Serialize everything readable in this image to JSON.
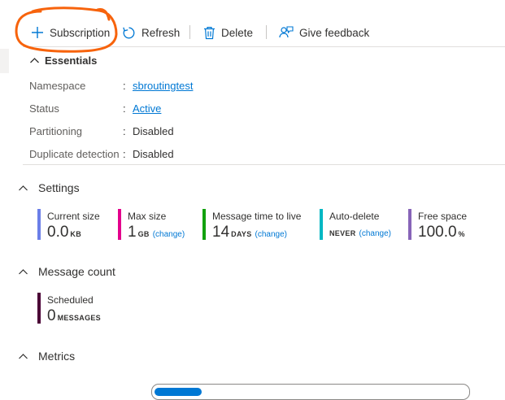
{
  "toolbar": {
    "subscription_label": "Subscription",
    "refresh_label": "Refresh",
    "delete_label": "Delete",
    "feedback_label": "Give feedback"
  },
  "essentials": {
    "title": "Essentials",
    "rows": [
      {
        "label": "Namespace",
        "value": "sbroutingtest"
      },
      {
        "label": "Status",
        "value": "Active"
      },
      {
        "label": "Partitioning",
        "value": "Disabled"
      },
      {
        "label": "Duplicate detection",
        "value": "Disabled"
      }
    ]
  },
  "settings": {
    "title": "Settings",
    "tiles": [
      {
        "label": "Current size",
        "value": "0.0",
        "unit": "KB",
        "change": "",
        "color": "#6b7fe8"
      },
      {
        "label": "Max size",
        "value": "1",
        "unit": "GB",
        "change": "(change)",
        "color": "#e3008c"
      },
      {
        "label": "Message time to live",
        "value": "14",
        "unit": "DAYS",
        "change": "(change)",
        "color": "#13a10e"
      },
      {
        "label": "Auto-delete",
        "value": "",
        "unit": "NEVER",
        "change": "(change)",
        "color": "#00b7c3"
      },
      {
        "label": "Free space",
        "value": "100.0",
        "unit": "%",
        "change": "",
        "color": "#8764b8"
      }
    ]
  },
  "message_count": {
    "title": "Message count",
    "tiles": [
      {
        "label": "Scheduled",
        "value": "0",
        "unit": "MESSAGES",
        "color": "#4b0036"
      }
    ]
  },
  "metrics": {
    "title": "Metrics"
  },
  "colors": {
    "accent": "#0078d4",
    "annotation": "#f7630c"
  },
  "icons": [
    "plus-icon",
    "refresh-icon",
    "delete-icon",
    "feedback-icon",
    "chevron-up-icon"
  ]
}
